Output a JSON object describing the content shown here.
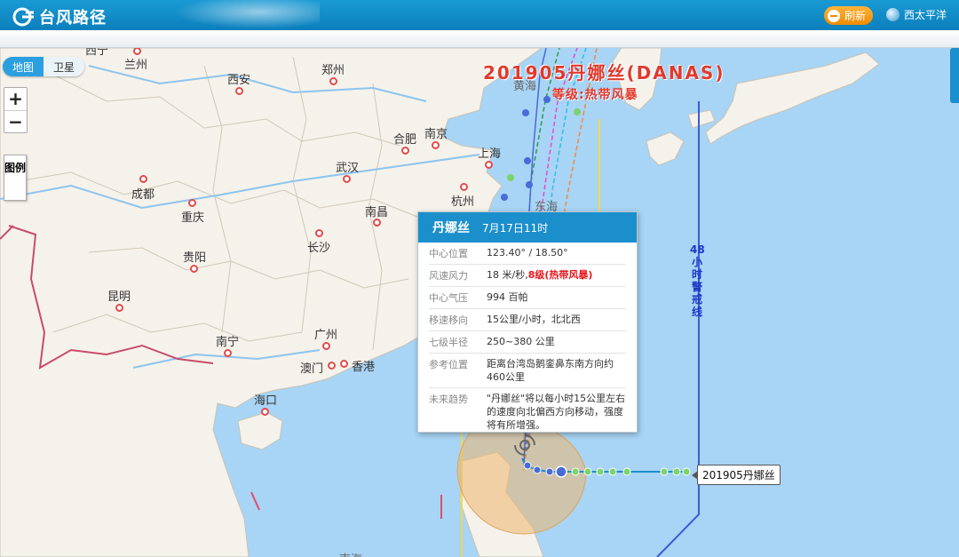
{
  "header": {
    "app_title": "台风路径",
    "refresh_label": "刷新",
    "region_label": "西太平洋"
  },
  "map_controls": {
    "layer_map": "地图",
    "layer_satellite": "卫星",
    "zoom_in": "+",
    "zoom_out": "−",
    "legend_label": "图例"
  },
  "storm": {
    "title": "201905丹娜丝(DANAS)",
    "grade": "等级:热带风暴",
    "tag_label": "201905丹娜丝",
    "warning_line_label": "48小时警戒线"
  },
  "cities": [
    "西宁",
    "兰州",
    "西安",
    "郑州",
    "合肥",
    "南京",
    "上海",
    "武汉",
    "杭州",
    "成都",
    "重庆",
    "长沙",
    "南昌",
    "贵阳",
    "昆明",
    "南宁",
    "广州",
    "澳门",
    "香港",
    "海口"
  ],
  "seas": [
    "黄海",
    "东海",
    "南海"
  ],
  "popup": {
    "name": "丹娜丝",
    "time": "7月17日11时",
    "rows": [
      {
        "key": "中心位置",
        "value": "123.40° / 18.50°"
      },
      {
        "key": "风速风力",
        "value": "18 米/秒,",
        "level": "8级(热带风暴)"
      },
      {
        "key": "中心气压",
        "value": "994 百帕"
      },
      {
        "key": "移速移向",
        "value": "15公里/小时，北北西"
      },
      {
        "key": "七级半径",
        "value": "250~380 公里"
      },
      {
        "key": "参考位置",
        "value": "距离台湾岛鹅銮鼻东南方向约460公里"
      },
      {
        "key": "未来趋势",
        "value": "\"丹娜丝\"将以每小时15公里左右的速度向北偏西方向移动，强度将有所增强。"
      }
    ]
  },
  "colors": {
    "header_blue": "#1a8fcc",
    "sea": "#a8d4f5",
    "land": "#f5f2eb",
    "warning_line": "#3b5bd8",
    "title_red": "#e03a2e",
    "refresh_orange": "#ef8a00"
  }
}
